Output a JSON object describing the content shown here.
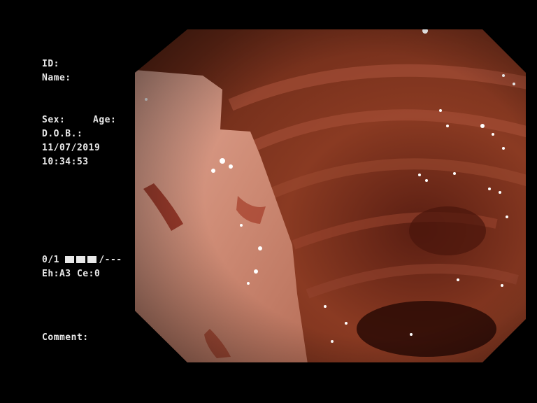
{
  "patient": {
    "id_label": "ID:",
    "name_label": "Name:",
    "sex_label": "Sex:",
    "age_label": "Age:",
    "dob_label": "D.O.B.:",
    "date": "11/07/2019",
    "time": "10:34:53"
  },
  "status": {
    "bar_suffix": "/---",
    "counter": "0/1",
    "enhancement": "Eh:A3 Ce:0"
  },
  "comment_label": "Comment:",
  "colors": {
    "background": "#000000",
    "overlay_text": "#e8e8e8",
    "mucosa": "#8a3a22",
    "lesion": "#d99a86"
  }
}
